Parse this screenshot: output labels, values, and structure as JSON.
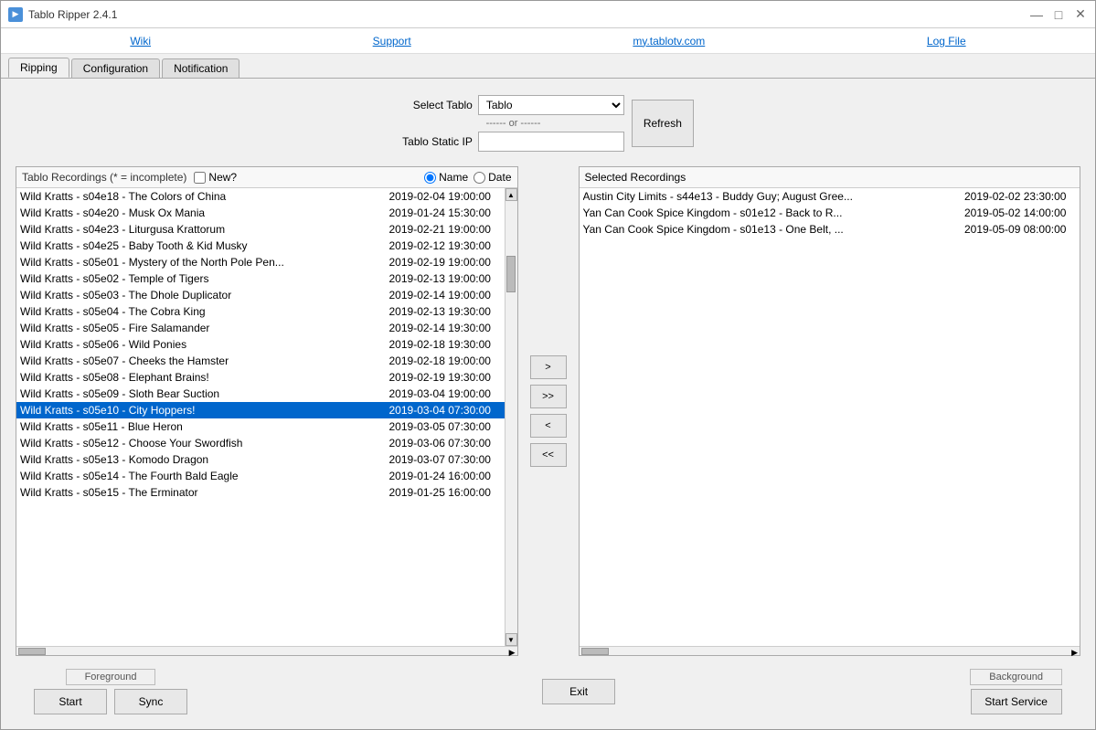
{
  "window": {
    "title": "Tablo Ripper 2.4.1"
  },
  "menu": {
    "wiki": "Wiki",
    "support": "Support",
    "mytablotv": "my.tablotv.com",
    "logfile": "Log File"
  },
  "tabs": [
    {
      "label": "Ripping",
      "active": true
    },
    {
      "label": "Configuration",
      "active": false
    },
    {
      "label": "Notification",
      "active": false
    }
  ],
  "controls": {
    "select_tablo_label": "Select Tablo",
    "or_label": "------ or ------",
    "static_ip_label": "Tablo Static IP",
    "tablo_value": "Tablo",
    "refresh_label": "Refresh",
    "tablo_options": [
      "Tablo"
    ]
  },
  "recordings_panel": {
    "title": "Tablo Recordings (* = incomplete)",
    "new_label": "New?",
    "sort_name_label": "Name",
    "sort_date_label": "Date"
  },
  "recordings": [
    {
      "name": "Wild Kratts - s04e18 - The Colors of China",
      "date": "2019-02-04 19:00:00",
      "selected": false
    },
    {
      "name": "Wild Kratts - s04e20 - Musk Ox Mania",
      "date": "2019-01-24 15:30:00",
      "selected": false
    },
    {
      "name": "Wild Kratts - s04e23 - Liturgusa Krattorum",
      "date": "2019-02-21 19:00:00",
      "selected": false
    },
    {
      "name": "Wild Kratts - s04e25 - Baby Tooth & Kid Musky",
      "date": "2019-02-12 19:30:00",
      "selected": false
    },
    {
      "name": "Wild Kratts - s05e01 - Mystery of the North Pole Pen...",
      "date": "2019-02-19 19:00:00",
      "selected": false
    },
    {
      "name": "Wild Kratts - s05e02 - Temple of Tigers",
      "date": "2019-02-13 19:00:00",
      "selected": false
    },
    {
      "name": "Wild Kratts - s05e03 - The Dhole Duplicator",
      "date": "2019-02-14 19:00:00",
      "selected": false
    },
    {
      "name": "Wild Kratts - s05e04 - The Cobra King",
      "date": "2019-02-13 19:30:00",
      "selected": false
    },
    {
      "name": "Wild Kratts - s05e05 - Fire Salamander",
      "date": "2019-02-14 19:30:00",
      "selected": false
    },
    {
      "name": "Wild Kratts - s05e06 - Wild Ponies",
      "date": "2019-02-18 19:30:00",
      "selected": false
    },
    {
      "name": "Wild Kratts - s05e07 - Cheeks the Hamster",
      "date": "2019-02-18 19:00:00",
      "selected": false
    },
    {
      "name": "Wild Kratts - s05e08 - Elephant Brains!",
      "date": "2019-02-19 19:30:00",
      "selected": false
    },
    {
      "name": "Wild Kratts - s05e09 - Sloth Bear Suction",
      "date": "2019-03-04 19:00:00",
      "selected": false
    },
    {
      "name": "Wild Kratts - s05e10 - City Hoppers!",
      "date": "2019-03-04 07:30:00",
      "selected": true
    },
    {
      "name": "Wild Kratts - s05e11 - Blue Heron",
      "date": "2019-03-05 07:30:00",
      "selected": false
    },
    {
      "name": "Wild Kratts - s05e12 - Choose Your Swordfish",
      "date": "2019-03-06 07:30:00",
      "selected": false
    },
    {
      "name": "Wild Kratts - s05e13 - Komodo Dragon",
      "date": "2019-03-07 07:30:00",
      "selected": false
    },
    {
      "name": "Wild Kratts - s05e14 - The Fourth Bald Eagle",
      "date": "2019-01-24 16:00:00",
      "selected": false
    },
    {
      "name": "Wild Kratts - s05e15 - The Erminator",
      "date": "2019-01-25 16:00:00",
      "selected": false
    }
  ],
  "arrow_buttons": {
    "add_one": ">",
    "add_all": ">>",
    "remove_one": "<",
    "remove_all": "<<"
  },
  "selected_panel": {
    "title": "Selected Recordings"
  },
  "selected_recordings": [
    {
      "name": "Austin City Limits - s44e13 - Buddy Guy; August Gree...",
      "date": "2019-02-02 23:30:00"
    },
    {
      "name": "Yan Can Cook Spice Kingdom - s01e12 - Back to R...",
      "date": "2019-05-02 14:00:00"
    },
    {
      "name": "Yan Can Cook Spice Kingdom - s01e13 - One Belt, ...",
      "date": "2019-05-09 08:00:00"
    }
  ],
  "bottom": {
    "foreground_label": "Foreground",
    "background_label": "Background",
    "start_label": "Start",
    "sync_label": "Sync",
    "exit_label": "Exit",
    "start_service_label": "Start Service"
  }
}
